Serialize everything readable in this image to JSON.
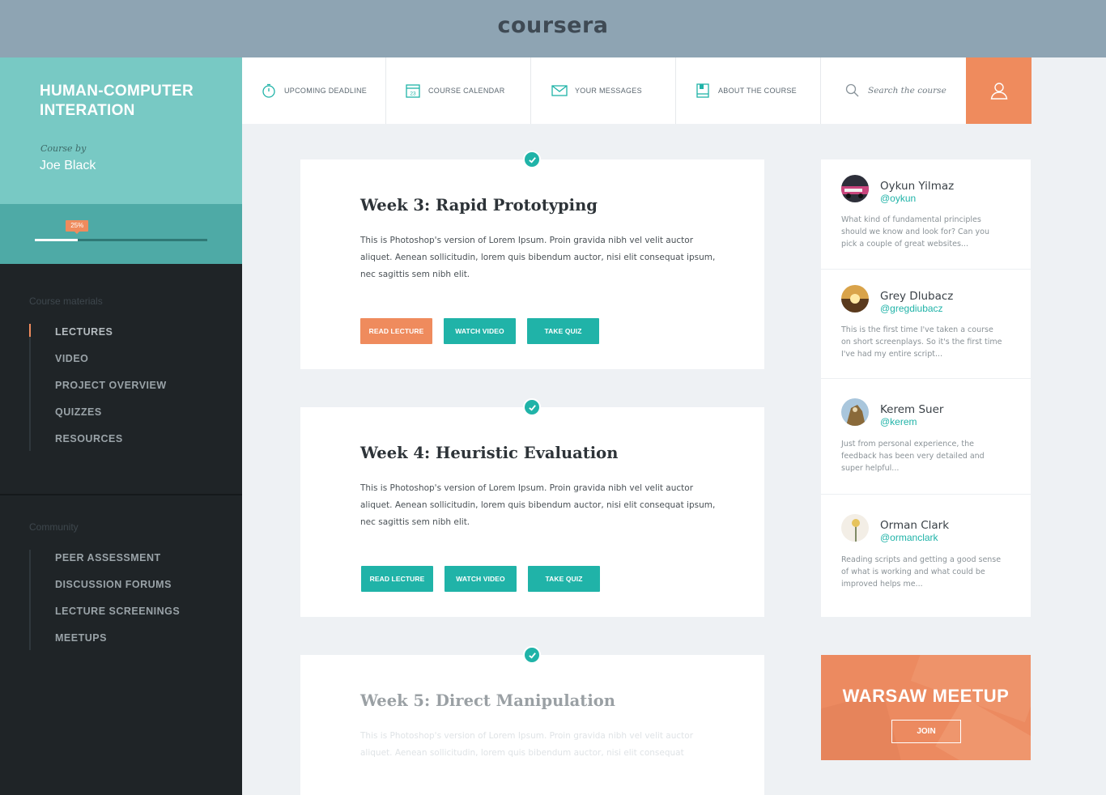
{
  "brand": {
    "logo_text": "coursera"
  },
  "course": {
    "title": "HUMAN-COMPUTER INTERATION",
    "by_label": "Course by",
    "author": "Joe Black",
    "progress_label": "25%",
    "progress_value": 0.25
  },
  "sidebar": {
    "materials_title": "Course materials",
    "materials": [
      {
        "label": "LECTURES",
        "active": true
      },
      {
        "label": "VIDEO"
      },
      {
        "label": "PROJECT OVERVIEW"
      },
      {
        "label": "QUIZZES"
      },
      {
        "label": "RESOURCES"
      }
    ],
    "community_title": "Community",
    "community": [
      {
        "label": "PEER ASSESSMENT"
      },
      {
        "label": "DISCUSSION FORUMS"
      },
      {
        "label": "LECTURE SCREENINGS"
      },
      {
        "label": "MEETUPS"
      }
    ]
  },
  "topnav": {
    "items": [
      {
        "label": "UPCOMING DEADLINE",
        "icon": "timer-icon"
      },
      {
        "label": "COURSE CALENDAR",
        "icon": "calendar-icon",
        "calendar_day": "23"
      },
      {
        "label": "YOUR MESSAGES",
        "icon": "envelope-icon"
      },
      {
        "label": "ABOUT THE COURSE",
        "icon": "book-icon"
      }
    ],
    "search_placeholder": "Search the course",
    "user_icon": "user-icon"
  },
  "weeks": [
    {
      "title": "Week 3: Rapid Prototyping",
      "text": "This is Photoshop's version of Lorem Ipsum. Proin gravida nibh vel velit auctor aliquet. Aenean sollicitudin, lorem quis bibendum auctor, nisi elit consequat ipsum, nec sagittis sem nibh elit.",
      "read_label": "READ LECTURE",
      "watch_label": "WATCH VIDEO",
      "quiz_label": "TAKE QUIZ"
    },
    {
      "title": "Week 4: Heuristic Evaluation",
      "text": "This is Photoshop's version of Lorem Ipsum. Proin gravida nibh vel velit auctor aliquet. Aenean sollicitudin, lorem quis bibendum auctor, nisi elit consequat ipsum, nec sagittis sem nibh elit.",
      "read_label": "READ LECTURE",
      "watch_label": "WATCH VIDEO",
      "quiz_label": "TAKE QUIZ"
    },
    {
      "title": "Week 5: Direct Manipulation",
      "text": "This is Photoshop's version of Lorem Ipsum. Proin gravida nibh vel velit auctor aliquet. Aenean sollicitudin, lorem quis bibendum auctor, nisi elit consequat"
    }
  ],
  "comments": [
    {
      "name": "Oykun Yilmaz",
      "handle": "@oykun",
      "text": "What kind of fundamental principles should we know and look for? Can you pick a couple of  great websites..."
    },
    {
      "name": "Grey Dlubacz",
      "handle": "@gregdiubacz",
      "text": "This is the first time I've taken a course on short screenplays. So it's the first time I've had my entire script..."
    },
    {
      "name": "Kerem Suer",
      "handle": "@kerem",
      "text": "Just from personal experience, the feedback has been very detailed and super helpful..."
    },
    {
      "name": "Orman Clark",
      "handle": "@ormanclark",
      "text": "Reading scripts and getting a good sense of what is working and what could be improved helps me..."
    }
  ],
  "meetup": {
    "title": "WARSAW MEETUP",
    "join_label": "JOIN"
  },
  "colors": {
    "accent_orange": "#ef8b5d",
    "accent_teal": "#20b3a8",
    "sidebar_dark": "#1f2427",
    "header_teal": "#78c9c4"
  }
}
